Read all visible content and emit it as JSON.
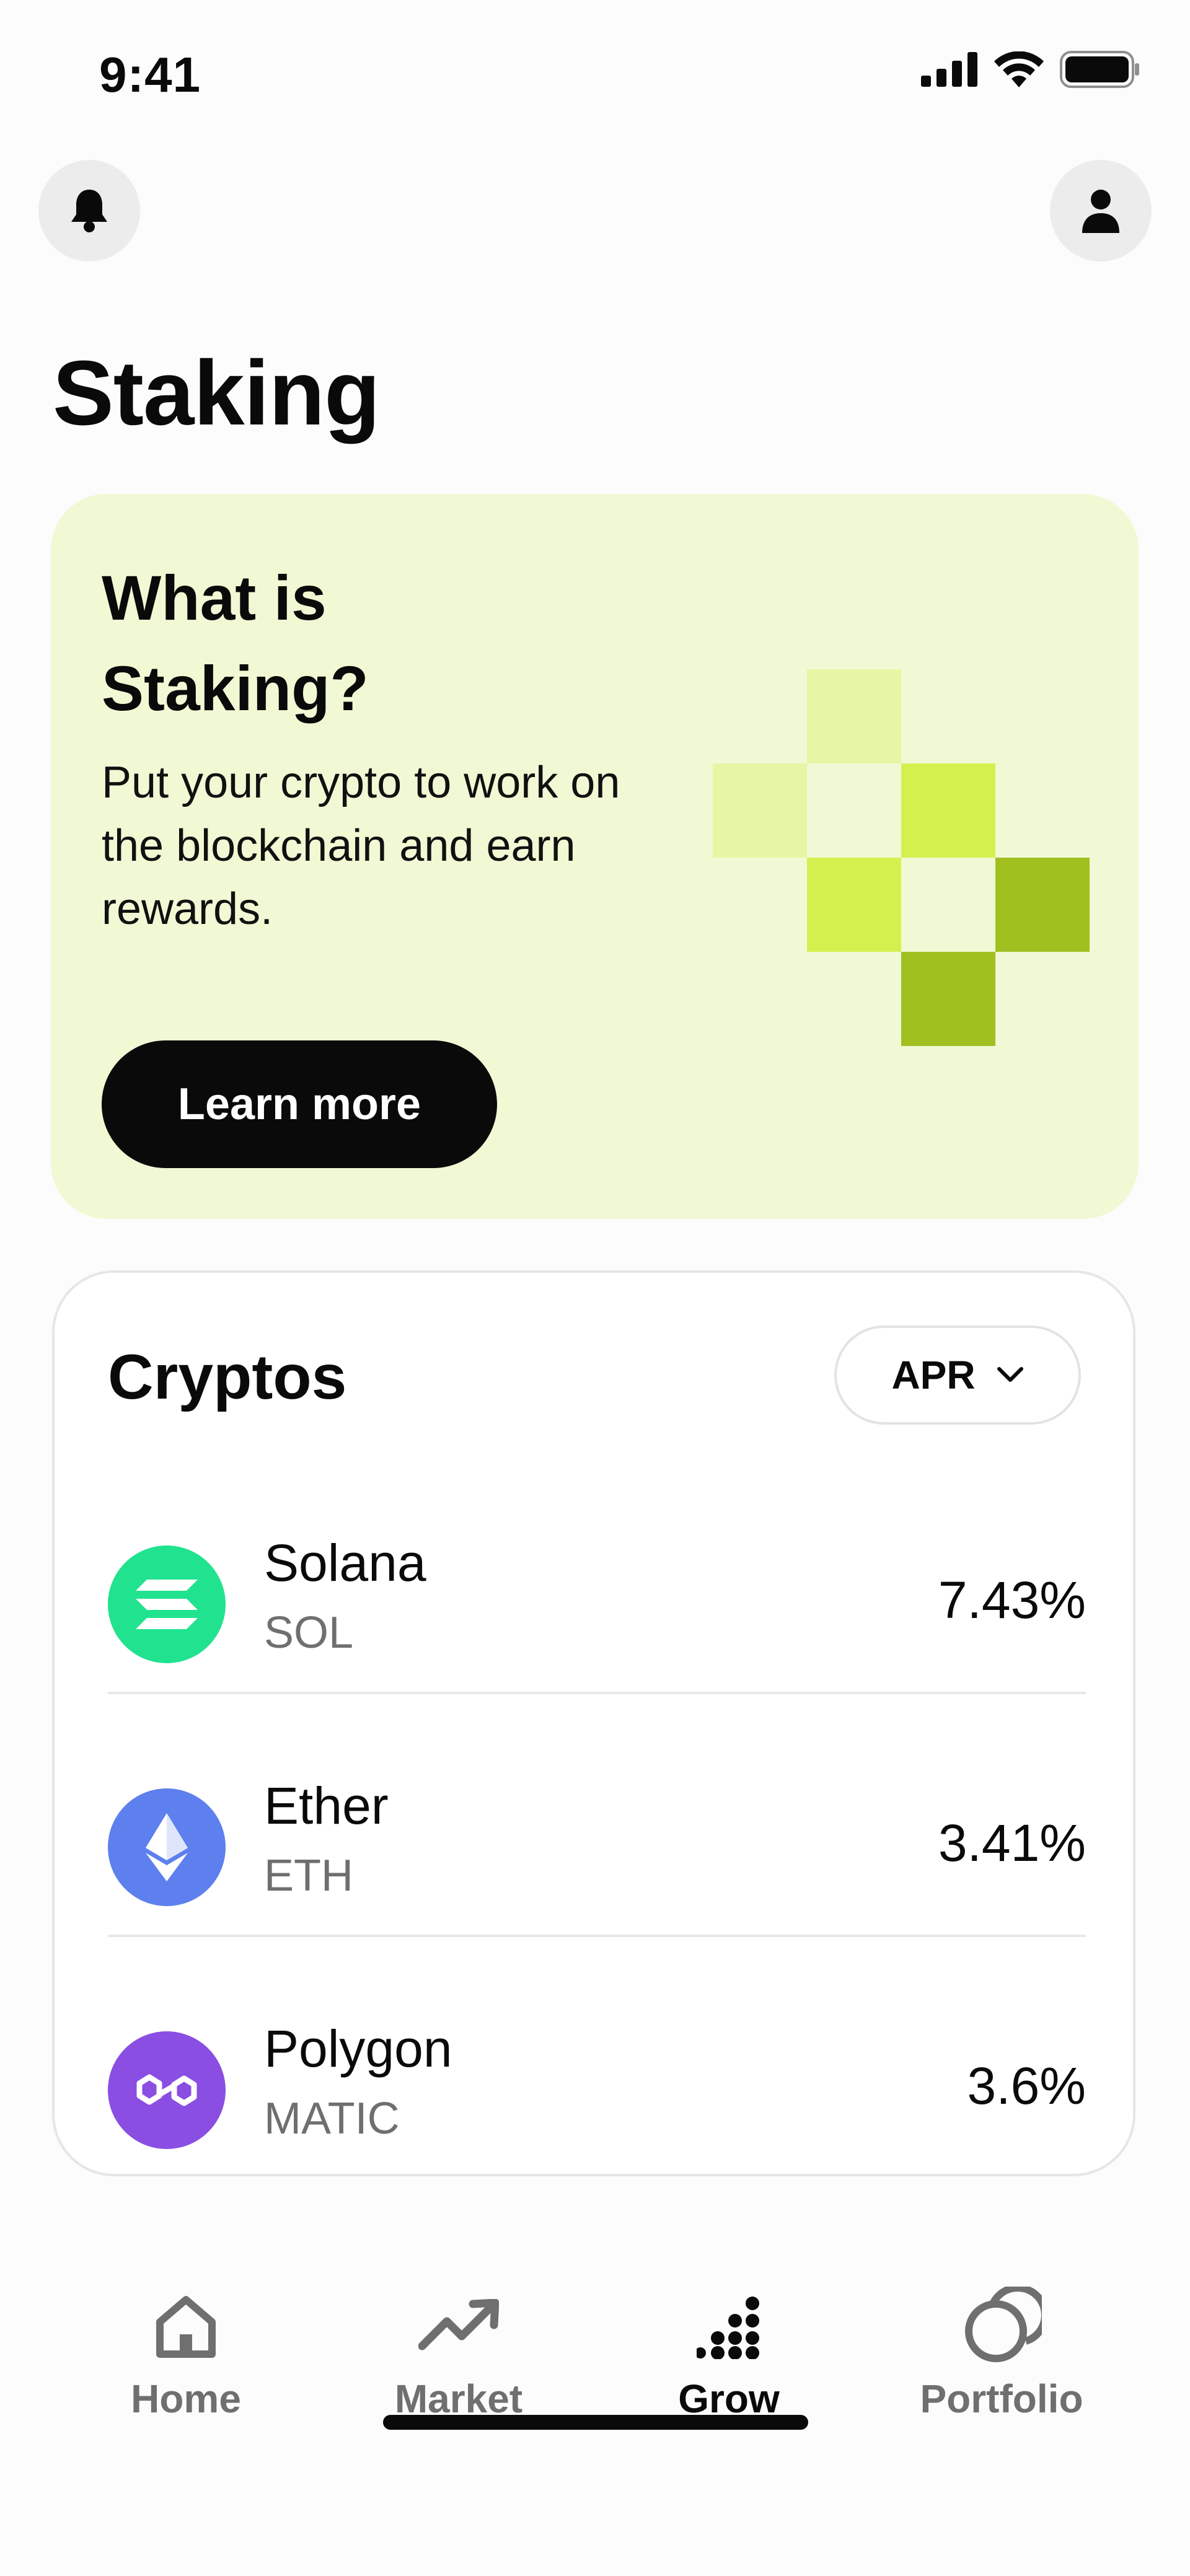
{
  "status_bar": {
    "time": "9:41"
  },
  "header": {
    "left_icon": "bell-icon",
    "right_icon": "user-icon",
    "title": "Staking"
  },
  "hero": {
    "title": "What is Staking?",
    "description": "Put your crypto to work on the blockchain and earn rewards.",
    "button_label": "Learn more",
    "colors": {
      "background": "#f1f9d4",
      "pixel_light": "#e6f6a4",
      "pixel_mid": "#d4f04f",
      "pixel_dark": "#a0c020"
    }
  },
  "cryptos": {
    "title": "Cryptos",
    "sort": {
      "selected": "APR",
      "icon": "chevron-down-icon"
    },
    "items": [
      {
        "name": "Solana",
        "symbol": "SOL",
        "rate": "7.43%",
        "icon": "solana-icon",
        "color": "#21e38f"
      },
      {
        "name": "Ether",
        "symbol": "ETH",
        "rate": "3.41%",
        "icon": "ethereum-icon",
        "color": "#5e80ee"
      },
      {
        "name": "Polygon",
        "symbol": "MATIC",
        "rate": "3.6%",
        "icon": "polygon-icon",
        "color": "#8a4ee3"
      }
    ]
  },
  "nav": {
    "items": [
      {
        "label": "Home",
        "icon": "home-icon",
        "active": false
      },
      {
        "label": "Market",
        "icon": "trend-up-icon",
        "active": false
      },
      {
        "label": "Grow",
        "icon": "dots-grow-icon",
        "active": true
      },
      {
        "label": "Portfolio",
        "icon": "portfolio-circles-icon",
        "active": false
      }
    ]
  }
}
